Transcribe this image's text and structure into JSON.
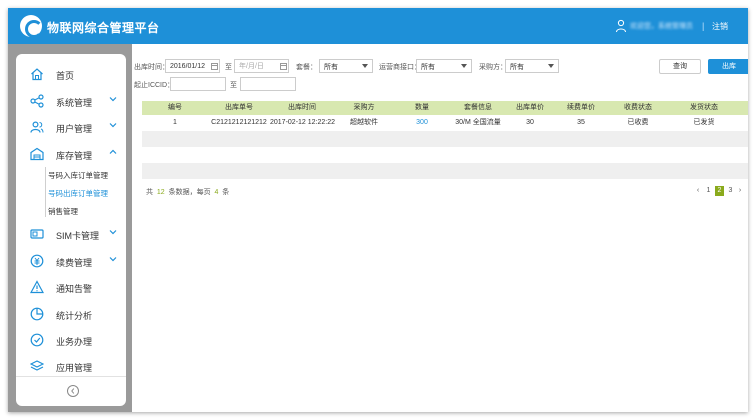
{
  "header": {
    "app_title": "物联网综合管理平台",
    "user_name": "欢迎您，系统管理员",
    "divider": "|",
    "logout": "注销"
  },
  "sidebar": {
    "items": [
      {
        "label": "首页",
        "icon": "home-icon",
        "expandable": false
      },
      {
        "label": "系统管理",
        "icon": "share-icon",
        "expandable": true
      },
      {
        "label": "用户管理",
        "icon": "users-icon",
        "expandable": true
      },
      {
        "label": "库存管理",
        "icon": "warehouse-icon",
        "expandable": true,
        "expanded": true
      },
      {
        "label": "SIM卡管理",
        "icon": "sim-card-icon",
        "expandable": true
      },
      {
        "label": "续费管理",
        "icon": "renew-coin-icon",
        "expandable": true
      },
      {
        "label": "通知告警",
        "icon": "alert-icon",
        "expandable": false
      },
      {
        "label": "统计分析",
        "icon": "pie-chart-icon",
        "expandable": false
      },
      {
        "label": "业务办理",
        "icon": "business-icon",
        "expandable": false
      },
      {
        "label": "应用管理",
        "icon": "layers-icon",
        "expandable": false
      }
    ],
    "sub_items": [
      {
        "label": "号码入库订单管理",
        "active": false
      },
      {
        "label": "号码出库订单管理",
        "active": true
      },
      {
        "label": "销售管理",
        "active": false
      }
    ]
  },
  "filters": {
    "out_time_label": "出库时间：",
    "start_date": "2016/01/12",
    "to_label_1": "至",
    "end_date_placeholder": "年/月/日",
    "package_label": "套餐：",
    "package_value": "所有",
    "operator_label": "运营商接口：",
    "operator_value": "所有",
    "buyer_label": "采购方：",
    "buyer_value": "所有",
    "iccid_label": "起止ICCID：",
    "to_label_2": "至",
    "query_button": "查询",
    "out_button": "出库"
  },
  "table": {
    "columns": [
      "编号",
      "出库单号",
      "出库时间",
      "采购方",
      "数量",
      "套餐信息",
      "出库单价",
      "续费单价",
      "收费状态",
      "发货状态"
    ],
    "rows": [
      [
        "1",
        "C2121212121212",
        "2017-02-12 12:22:22",
        "超越软件",
        "300",
        "30/M 全国流量",
        "30",
        "35",
        "已收费",
        "已发货"
      ]
    ]
  },
  "footer": {
    "prefix": "共",
    "total": "12",
    "mid": "条数据，每页",
    "per_page": "4",
    "suffix": "条",
    "prev": "‹",
    "pages": [
      "1",
      "2",
      "3"
    ],
    "current_page": "2",
    "next": "›"
  },
  "colors": {
    "primary": "#1e90d8",
    "header_row": "#d8e8b0",
    "accent_green": "#8aaa1c"
  }
}
